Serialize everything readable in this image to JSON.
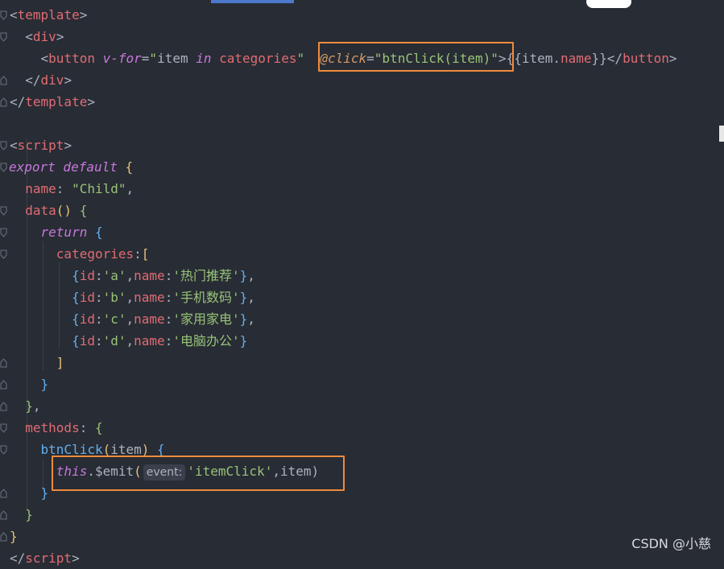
{
  "code": {
    "l1_open": "<",
    "l1_tag": "template",
    "l1_close": ">",
    "l2_open": "<",
    "l2_tag": "div",
    "l2_close": ">",
    "l3_open": "<",
    "l3_tag": "button",
    "l3_vfor": "v-for",
    "l3_eq": "=",
    "l3_val_q1": "\"",
    "l3_item": "item",
    "l3_in": " in ",
    "l3_cat": "categories",
    "l3_val_q2": "\"",
    "l3_click": "@click",
    "l3_eq2": "=",
    "l3_click_val": "\"btnClick(item)\"",
    "l3_gt": ">",
    "l3_mustache": "{{item.",
    "l3_name": "name",
    "l3_mustache_end": "}}",
    "l3_endtag_open": "</",
    "l3_endtag": "button",
    "l3_endtag_close": ">",
    "l4_open": "</",
    "l4_tag": "div",
    "l4_close": ">",
    "l5_open": "</",
    "l5_tag": "template",
    "l5_close": ">",
    "l7_open": "<",
    "l7_tag": "script",
    "l7_close": ">",
    "l8_export": "export",
    "l8_default": " default",
    "l8_brace": " {",
    "l9_name": "name",
    "l9_colon": ": ",
    "l9_val": "\"Child\"",
    "l9_comma": ",",
    "l10_data": "data",
    "l10_parens": "()",
    "l10_brace": " {",
    "l11_return": "return",
    "l11_brace": " {",
    "l12_categories": "categories",
    "l12_colon": ":",
    "l12_bracket": "[",
    "rows": [
      {
        "id": "'a'",
        "name": "'热门推荐'"
      },
      {
        "id": "'b'",
        "name": "'手机数码'"
      },
      {
        "id": "'c'",
        "name": "'家用家电'"
      },
      {
        "id": "'d'",
        "name": "'电脑办公'"
      }
    ],
    "row_open": "{",
    "row_id_key": "id",
    "row_colon": ":",
    "row_comma": ",",
    "row_name_key": "name",
    "row_close": "}",
    "row_trail": ",",
    "l17_bracket": "]",
    "l18_brace": "}",
    "l19_brace": "}",
    "l19_comma": ",",
    "l20_methods": "methods",
    "l20_colon": ": ",
    "l20_brace": "{",
    "l21_fn": "btnClick",
    "l21_paren_open": "(",
    "l21_arg": "item",
    "l21_paren_close": ")",
    "l21_brace": " {",
    "l22_this": "this",
    "l22_dot_emit": ".$emit",
    "l22_paren": "(",
    "l22_hint": "event:",
    "l22_str": "'itemClick'",
    "l22_rest": ",item)",
    "l23_brace": "}",
    "l24_brace": "}",
    "l25_brace": "}",
    "l26_open": "</",
    "l26_tag": "script",
    "l26_close": ">"
  },
  "watermark": "CSDN @小慈",
  "colors": {
    "background": "#282c34",
    "highlight_box": "#f18a3c",
    "tag": "#e06c75",
    "string": "#98c379",
    "keyword": "#c678dd",
    "function": "#61afef"
  }
}
